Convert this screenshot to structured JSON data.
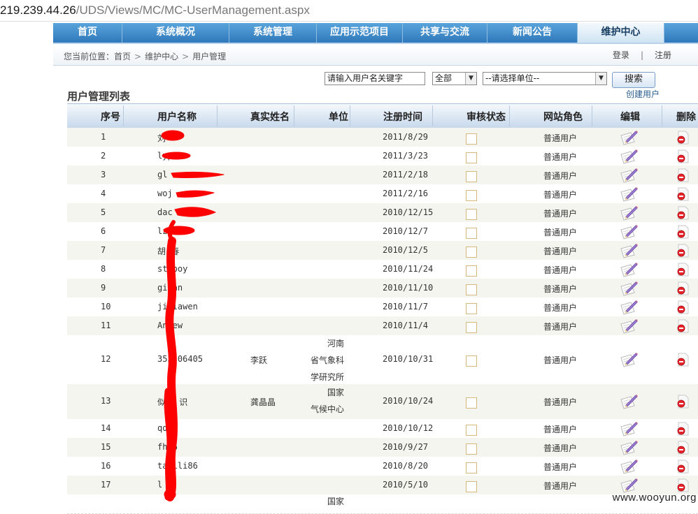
{
  "address_bar": {
    "host": "219.239.44.26",
    "path": "/UDS/Views/MC/MC-UserManagement.aspx"
  },
  "nav": [
    {
      "label": "首页"
    },
    {
      "label": "系统概况"
    },
    {
      "label": "系统管理"
    },
    {
      "label": "应用示范项目"
    },
    {
      "label": "共享与交流"
    },
    {
      "label": "新闻公告"
    },
    {
      "label": "维护中心",
      "active": true
    }
  ],
  "breadcrumb": {
    "prefix": "您当前位置：",
    "items": [
      "首页",
      "维护中心",
      "用户管理"
    ],
    "separator": ">"
  },
  "auth": {
    "login": "登录",
    "divider": "|",
    "register": "注册"
  },
  "search": {
    "keyword_value": "请输入用户名关键字",
    "status_select": "全部",
    "unit_select": "--请选择单位--",
    "button": "搜索",
    "create_user": "创建用户"
  },
  "list_title": "用户管理列表",
  "columns": [
    "序号",
    "用户名称",
    "真实姓名",
    "单位",
    "注册时间",
    "审核状态",
    "网站角色",
    "编辑",
    "删除"
  ],
  "rows": [
    {
      "no": "1",
      "username": "刘",
      "realname": "",
      "unit": [],
      "date": "2011/8/29",
      "role": "普通用户"
    },
    {
      "no": "2",
      "username": "lyp",
      "realname": "",
      "unit": [],
      "date": "2011/3/23",
      "role": "普通用户"
    },
    {
      "no": "3",
      "username": "gl",
      "realname": "",
      "unit": [],
      "date": "2011/2/18",
      "role": "普通用户"
    },
    {
      "no": "4",
      "username": "woj",
      "realname": "",
      "unit": [],
      "date": "2011/2/16",
      "role": "普通用户"
    },
    {
      "no": "5",
      "username": "dac",
      "realname": "",
      "unit": [],
      "date": "2010/12/15",
      "role": "普通用户"
    },
    {
      "no": "6",
      "username": "lz",
      "realname": "",
      "unit": [],
      "date": "2010/12/7",
      "role": "普通用户"
    },
    {
      "no": "7",
      "username": "胡 春",
      "realname": "",
      "unit": [],
      "date": "2010/12/5",
      "role": "普通用户"
    },
    {
      "no": "8",
      "username": "st  boy",
      "realname": "",
      "unit": [],
      "date": "2010/11/24",
      "role": "普通用户"
    },
    {
      "no": "9",
      "username": "gi  an",
      "realname": "",
      "unit": [],
      "date": "2010/11/10",
      "role": "普通用户"
    },
    {
      "no": "10",
      "username": "ji  iawen",
      "realname": "",
      "unit": [],
      "date": "2010/11/7",
      "role": "普通用户"
    },
    {
      "no": "11",
      "username": "An   ew",
      "realname": "",
      "unit": [],
      "date": "2010/11/4",
      "role": "普通用户"
    },
    {
      "no": "12",
      "username": "353 06405",
      "realname": "李跃",
      "unit": [
        "河南",
        "省气象科",
        "学研究所"
      ],
      "date": "2010/10/31",
      "role": "普通用户"
    },
    {
      "no": "13",
      "username": "似曾 识",
      "realname": "龚晶晶",
      "unit": [
        "国家",
        "气候中心"
      ],
      "date": "2010/10/24",
      "role": "普通用户"
    },
    {
      "no": "14",
      "username": "qdf",
      "realname": "",
      "unit": [],
      "date": "2010/10/12",
      "role": "普通用户"
    },
    {
      "no": "15",
      "username": "fh  6",
      "realname": "",
      "unit": [],
      "date": "2010/9/27",
      "role": "普通用户"
    },
    {
      "no": "16",
      "username": "ta  ili86",
      "realname": "",
      "unit": [],
      "date": "2010/8/20",
      "role": "普通用户"
    },
    {
      "no": "17",
      "username": "l",
      "realname": "",
      "unit": [],
      "date": "2010/5/10",
      "role": "普通用户"
    },
    {
      "no": "",
      "username": "",
      "realname": "",
      "unit": [
        "国家"
      ],
      "date": "",
      "role": ""
    }
  ],
  "watermark": "www.wooyun.org"
}
